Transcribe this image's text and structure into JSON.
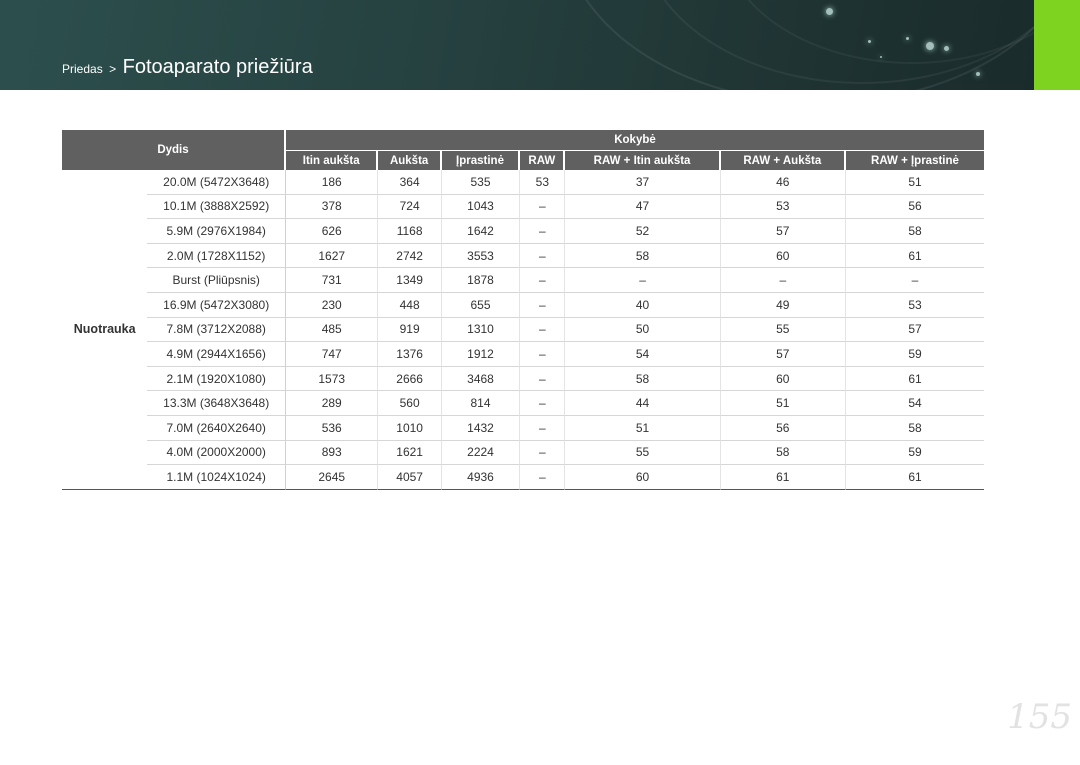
{
  "breadcrumb": {
    "parent": "Priedas",
    "separator": ">",
    "title": "Fotoaparato priežiūra"
  },
  "colors": {
    "header": "#25403f",
    "accent_tab": "#7ed321",
    "table_header": "#606060"
  },
  "table": {
    "size_header": "Dydis",
    "quality_header": "Kokybė",
    "quality_columns": [
      "Itin aukšta",
      "Aukšta",
      "Įprastinė",
      "RAW",
      "RAW + Itin aukšta",
      "RAW + Aukšta",
      "RAW + Įprastinė"
    ],
    "group_label": "Nuotrauka",
    "rows": [
      {
        "size": "20.0M (5472X3648)",
        "values": [
          "186",
          "364",
          "535",
          "53",
          "37",
          "46",
          "51"
        ]
      },
      {
        "size": "10.1M (3888X2592)",
        "values": [
          "378",
          "724",
          "1043",
          "–",
          "47",
          "53",
          "56"
        ]
      },
      {
        "size": "5.9M (2976X1984)",
        "values": [
          "626",
          "1168",
          "1642",
          "–",
          "52",
          "57",
          "58"
        ]
      },
      {
        "size": "2.0M (1728X1152)",
        "values": [
          "1627",
          "2742",
          "3553",
          "–",
          "58",
          "60",
          "61"
        ]
      },
      {
        "size": "Burst (Pliūpsnis)",
        "values": [
          "731",
          "1349",
          "1878",
          "–",
          "–",
          "–",
          "–"
        ]
      },
      {
        "size": "16.9M (5472X3080)",
        "values": [
          "230",
          "448",
          "655",
          "–",
          "40",
          "49",
          "53"
        ]
      },
      {
        "size": "7.8M (3712X2088)",
        "values": [
          "485",
          "919",
          "1310",
          "–",
          "50",
          "55",
          "57"
        ]
      },
      {
        "size": "4.9M (2944X1656)",
        "values": [
          "747",
          "1376",
          "1912",
          "–",
          "54",
          "57",
          "59"
        ]
      },
      {
        "size": "2.1M (1920X1080)",
        "values": [
          "1573",
          "2666",
          "3468",
          "–",
          "58",
          "60",
          "61"
        ]
      },
      {
        "size": "13.3M (3648X3648)",
        "values": [
          "289",
          "560",
          "814",
          "–",
          "44",
          "51",
          "54"
        ]
      },
      {
        "size": "7.0M (2640X2640)",
        "values": [
          "536",
          "1010",
          "1432",
          "–",
          "51",
          "56",
          "58"
        ]
      },
      {
        "size": "4.0M (2000X2000)",
        "values": [
          "893",
          "1621",
          "2224",
          "–",
          "55",
          "58",
          "59"
        ]
      },
      {
        "size": "1.1M (1024X1024)",
        "values": [
          "2645",
          "4057",
          "4936",
          "–",
          "60",
          "61",
          "61"
        ]
      }
    ]
  },
  "page_number": "155"
}
